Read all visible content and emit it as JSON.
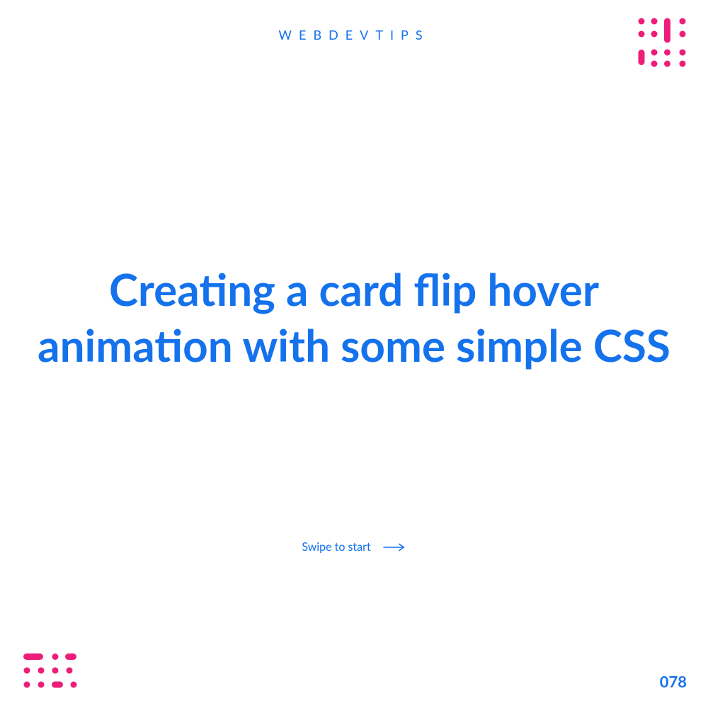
{
  "brand": "WEBDEVTIPS",
  "title": "Creating a card flip hover animation with some simple CSS",
  "swipe_label": "Swipe to start",
  "page_number": "078",
  "colors": {
    "primary": "#1572ED",
    "accent": "#ED1E79"
  }
}
